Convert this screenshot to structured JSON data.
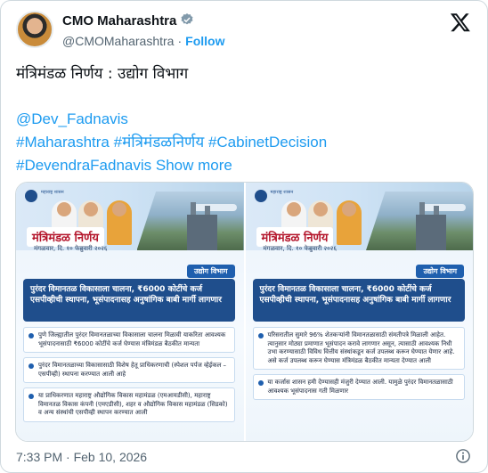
{
  "author": {
    "name": "CMO Maharashtra",
    "handle": "@CMOMaharashtra",
    "separator": "·",
    "follow_label": "Follow"
  },
  "tweet": {
    "headline": "मंत्रिमंडळ निर्णय : उद्योग विभाग",
    "mention": "@Dev_Fadnavis",
    "tags_line1": [
      "#Maharashtra",
      "#मंत्रिमंडळनिर्णय",
      "#CabinetDecision"
    ],
    "tags_line2": [
      "#DevendraFadnavis"
    ],
    "show_more": "Show more"
  },
  "media": {
    "panels": [
      {
        "emblem_text": "महाराष्ट्र शासन",
        "title": "मंत्रिमंडळ निर्णय",
        "date": "मंगळवार, दि. १० फेब्रुवारी २०२६",
        "dept": "उद्योग विभाग",
        "headline": "पुरंदर विमानतळ विकासाला चालना, ₹6000 कोटींचे कर्ज एसपीव्हीची स्थापना, भूसंपादनासह अनुषांगिक बाबी मार्गी लागणार",
        "bullets": [
          "पुणे जिल्ह्यातील पुरंदर विमानतळाच्या विकासाला चालना मिळावी याकरिता आवश्यक भूसंपादनासाठी ₹6000 कोटींचे कर्ज घेण्यास मंत्रिमंडळ बैठकीत मान्यता",
          "पुरंदर विमानतळाच्या विकासासाठी विशेष हेतू प्राधिकरणाची (स्पेशल पर्पज व्हेईकल – एसपीव्ही) स्थापना करण्यात आली आहे",
          "या प्राधिकरणात महाराष्ट्र औद्योगिक विकास महामंडळ (एमआयडीसी), महाराष्ट्र विमानतळ विकास कंपनी (एमएडीसी), शहर व औद्योगिक विकास महामंडळ (सिडको) व अन्य संस्थांची एसपीव्ही स्थापन करण्यात आली"
        ]
      },
      {
        "emblem_text": "महाराष्ट्र शासन",
        "title": "मंत्रिमंडळ निर्णय",
        "date": "मंगळवार, दि. १० फेब्रुवारी २०२६",
        "dept": "उद्योग विभाग",
        "headline": "पुरंदर विमानतळ विकासाला चालना, ₹6000 कोटींचे कर्ज एसपीव्हीची स्थापना, भूसंपादनासह अनुषांगिक बाबी मार्गी लागणार",
        "bullets": [
          "परिसरातील सुमारे 96% शेतकऱ्यांनी विमानतळासाठी संमतीपत्रे मिळाली आहेत. त्यानुसार मोठ्या प्रमाणात भूसंपादन करावे लागणार असून, त्यासाठी आवश्यक निधी उभा करण्यासाठी विविध वित्तीय संस्थांकडून कर्ज उपलब्ध करून घेण्यात येणार आहे. असे कर्ज उपलब्ध करून घेण्यास मंत्रिमंडळ बैठकीत मान्यता देण्यात आली",
          "या कर्जास शासन हमी देण्यासही मंजुरी देण्यात आली. यामुळे पुरंदर विमानतळासाठी आवश्यक भूसंपादनास गती मिळणार"
        ]
      }
    ]
  },
  "footer": {
    "timestamp": "7:33 PM · Feb 10, 2026"
  },
  "icons": {
    "verified": "verified-badge-icon",
    "x_logo": "x-logo-icon",
    "info": "info-icon"
  },
  "colors": {
    "link": "#1d9bf0",
    "text": "#0f1419",
    "muted": "#536471"
  }
}
